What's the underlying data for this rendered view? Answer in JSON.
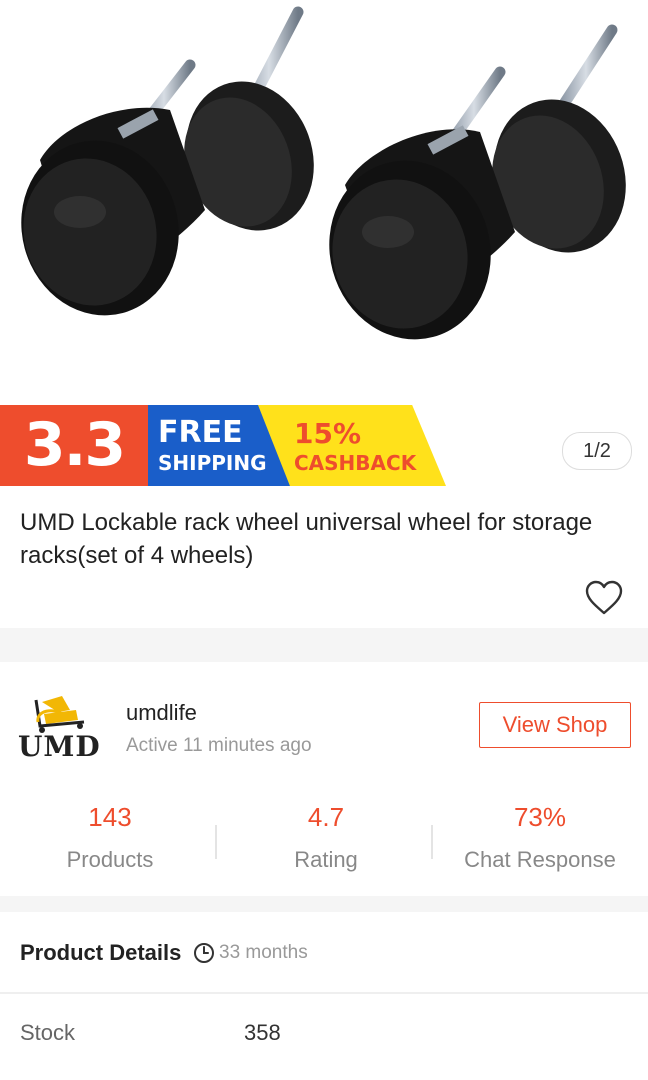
{
  "promo": {
    "sale_label": "3.3",
    "free_line1": "FREE",
    "free_line2": "SHIPPING",
    "cash_line1": "15%",
    "cash_line2": "CASHBACK",
    "colors": {
      "orange": "#ee4d2d",
      "blue": "#1a5ec9",
      "yellow": "#ffe11b"
    }
  },
  "gallery": {
    "counter": "1/2",
    "image_name": "caster-wheels-image"
  },
  "product": {
    "title": "UMD Lockable rack wheel universal wheel for storage racks(set of 4 wheels)",
    "like_icon": "heart-icon"
  },
  "shop": {
    "logo_text": "UMD",
    "name": "umdlife",
    "active_status": "Active 11 minutes ago",
    "view_shop_label": "View Shop",
    "stats": [
      {
        "value": "143",
        "label": "Products"
      },
      {
        "value": "4.7",
        "label": "Rating"
      },
      {
        "value": "73%",
        "label": "Chat Response"
      }
    ]
  },
  "details": {
    "heading": "Product Details",
    "age_icon": "clock-icon",
    "age": "33 months",
    "rows": [
      {
        "label": "Stock",
        "value": "358"
      }
    ]
  }
}
